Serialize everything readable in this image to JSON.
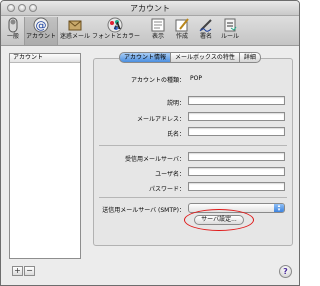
{
  "window": {
    "title": "アカウント"
  },
  "toolbar": {
    "items": [
      {
        "label": "一般",
        "icon": "switch-icon"
      },
      {
        "label": "アカウント",
        "icon": "at-sign-icon"
      },
      {
        "label": "迷惑メール",
        "icon": "junk-mail-icon"
      },
      {
        "label": "フォントとカラー",
        "icon": "font-color-icon"
      },
      {
        "label": "表示",
        "icon": "display-icon"
      },
      {
        "label": "作成",
        "icon": "compose-icon"
      },
      {
        "label": "署名",
        "icon": "signature-icon"
      },
      {
        "label": "ルール",
        "icon": "rules-icon"
      }
    ],
    "selected": "アカウント"
  },
  "sidebar": {
    "header": "アカウント",
    "add_label": "+",
    "remove_label": "−"
  },
  "tabs": [
    "アカウント情報",
    "メールボックスの特性",
    "詳細"
  ],
  "form": {
    "type_label": "アカウントの種類：",
    "type_value": "POP",
    "description_label": "説明：",
    "email_label": "メールアドレス：",
    "fullname_label": "氏名：",
    "incoming_server_label": "受信用メールサーバ：",
    "username_label": "ユーザ名：",
    "password_label": "パスワード：",
    "outgoing_server_label": "送信用メールサーバ (SMTP)：",
    "server_settings_button": "サーバ設定..."
  },
  "help_label": "?",
  "colors": {
    "accent": "#3d83de",
    "highlight": "#e01818"
  }
}
